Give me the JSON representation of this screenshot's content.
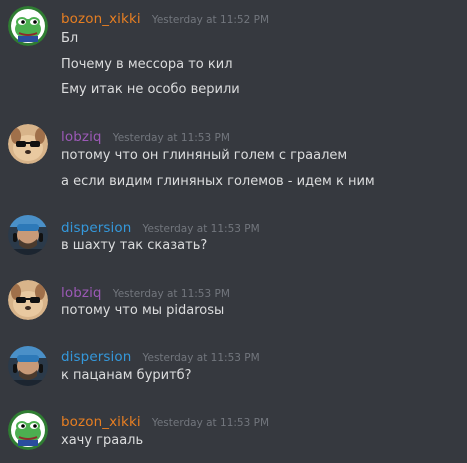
{
  "colors": {
    "background": "#36393f",
    "message_text": "#dcddde",
    "timestamp": "#72767d",
    "name_bozon": "#e67e22",
    "name_lobziq": "#9b59b6",
    "name_dispersion": "#3498db"
  },
  "messages": [
    {
      "username": "bozon_xikki",
      "timestamp": "Yesterday at 11:52 PM",
      "avatar": "pepe-frog-avatar",
      "lines": [
        "Бл",
        "Почему в мессора то кил",
        "Ему итак не особо верили"
      ]
    },
    {
      "username": "lobziq",
      "timestamp": "Yesterday at 11:53 PM",
      "avatar": "dog-sunglasses-avatar",
      "lines": [
        "потому что он глиняный голем с граалем",
        "а если видим глиняных големов - идем к ним"
      ]
    },
    {
      "username": "dispersion",
      "timestamp": "Yesterday at 11:53 PM",
      "avatar": "man-headset-avatar",
      "lines": [
        "в шахту так сказать?"
      ]
    },
    {
      "username": "lobziq",
      "timestamp": "Yesterday at 11:53 PM",
      "avatar": "dog-sunglasses-avatar",
      "lines": [
        "потому что мы pidarosы"
      ]
    },
    {
      "username": "dispersion",
      "timestamp": "Yesterday at 11:53 PM",
      "avatar": "man-headset-avatar",
      "lines": [
        "к пацанам буритб?"
      ]
    },
    {
      "username": "bozon_xikki",
      "timestamp": "Yesterday at 11:53 PM",
      "avatar": "pepe-frog-avatar",
      "lines": [
        "хачу грааль"
      ]
    }
  ]
}
